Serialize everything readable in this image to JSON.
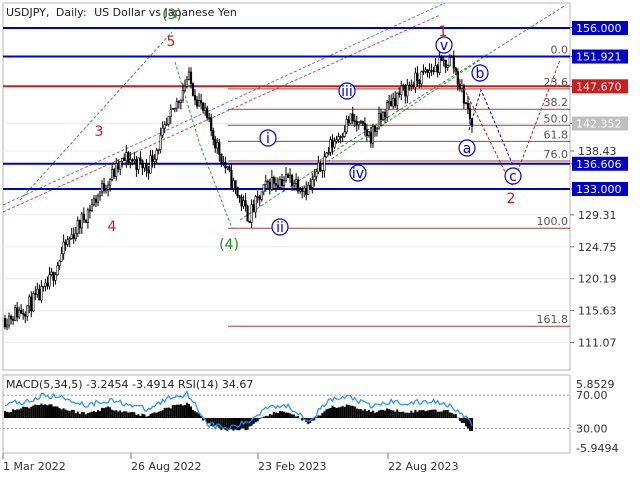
{
  "header": {
    "symbol": "USDJPY",
    "timeframe": "Daily:",
    "description": "US Dollar vs Japanese Yen"
  },
  "colors": {
    "blue": "#0000c8",
    "red": "#c81e1e",
    "green": "#2a8a2a",
    "gray_box": "#c0c0c0",
    "candle": "#000000"
  },
  "chart_data": [
    {
      "type": "line",
      "title": "USDJPY, Daily:  US Dollar vs Japanese Yen",
      "xlabel": "",
      "ylabel": "",
      "ylim": [
        108.5,
        158.5
      ],
      "x_tick_labels": [
        "1 Mar 2022",
        "26 Aug 2022",
        "23 Feb 2023",
        "22 Aug 2023"
      ],
      "y_tick_labels": [
        156.07,
        151.921,
        147.67,
        142.352,
        138.43,
        136.606,
        133.0,
        129.31,
        124.75,
        120.19,
        115.63,
        111.07
      ],
      "price_level_labels": [
        {
          "value": "156.000",
          "style": "blue"
        },
        {
          "value": "151.921",
          "style": "blue"
        },
        {
          "value": "147.670",
          "style": "red"
        },
        {
          "value": "142.352",
          "style": "gray"
        },
        {
          "value": "136.606",
          "style": "blue"
        },
        {
          "value": "133.000",
          "style": "blue"
        }
      ],
      "horizontal_lines": [
        {
          "value": 156.0,
          "color": "blue"
        },
        {
          "value": 151.921,
          "color": "blue"
        },
        {
          "value": 147.67,
          "color": "red"
        },
        {
          "value": 136.606,
          "color": "blue"
        },
        {
          "value": 133.0,
          "color": "blue"
        }
      ],
      "fib_levels": [
        {
          "label": "0.0",
          "value": 151.921
        },
        {
          "label": "23.6",
          "value": 147.3
        },
        {
          "label": "38.2",
          "value": 144.4
        },
        {
          "label": "50.0",
          "value": 142.1
        },
        {
          "label": "61.8",
          "value": 139.8
        },
        {
          "label": "76.0",
          "value": 137.0
        },
        {
          "label": "100.0",
          "value": 127.4
        },
        {
          "label": "161.8",
          "value": 113.4
        }
      ],
      "wave_labels": [
        {
          "text": "3",
          "color": "red"
        },
        {
          "text": "4",
          "color": "red"
        },
        {
          "text": "5",
          "color": "red"
        },
        {
          "text": "(3)",
          "color": "green"
        },
        {
          "text": "(4)",
          "color": "green"
        },
        {
          "text": "i",
          "color": "blue",
          "circled": true
        },
        {
          "text": "ii",
          "color": "blue",
          "circled": true
        },
        {
          "text": "iii",
          "color": "blue",
          "circled": true
        },
        {
          "text": "iv",
          "color": "blue",
          "circled": true
        },
        {
          "text": "v",
          "color": "blue",
          "circled": true
        },
        {
          "text": "1",
          "color": "red"
        },
        {
          "text": "a",
          "color": "blue",
          "circled": true
        },
        {
          "text": "b",
          "color": "blue",
          "circled": true
        },
        {
          "text": "c",
          "color": "blue",
          "circled": true
        },
        {
          "text": "2",
          "color": "red"
        }
      ],
      "series": [
        {
          "x": [
            "2022-01",
            "2022-02",
            "2022-03",
            "2022-04",
            "2022-05",
            "2022-06",
            "2022-07",
            "2022-08",
            "2022-09",
            "2022-10",
            "2022-11",
            "2022-12",
            "2023-01",
            "2023-02",
            "2023-03",
            "2023-04",
            "2023-05",
            "2023-06",
            "2023-07",
            "2023-08",
            "2023-09",
            "2023-10",
            "2023-11",
            "2023-12"
          ],
          "values": [
            114.5,
            116.0,
            118.5,
            125.0,
            129.5,
            134.0,
            137.5,
            136.0,
            142.0,
            149.0,
            142.5,
            135.0,
            129.0,
            134.0,
            134.5,
            133.0,
            139.0,
            143.0,
            140.5,
            145.5,
            148.0,
            150.0,
            151.5,
            142.4
          ]
        }
      ]
    },
    {
      "type": "line",
      "title": "MACD(5,34,5) -3.2454 -3.4914 RSI(14) 34.67",
      "indicator_title": "MACD(5,34,5) -3.2454 -3.4914 RSI(14) 34.67",
      "y_tick_labels": [
        "5.8529",
        "70.00",
        "30.00",
        "-5.9494"
      ],
      "rsi_levels": [
        70,
        30
      ],
      "series": [
        {
          "name": "MACD",
          "values": [
            1.5,
            2.5,
            3.5,
            2.0,
            1.0,
            2.5,
            1.5,
            0.5,
            2.5,
            3.5,
            -1.5,
            -3.0,
            -2.5,
            1.0,
            1.5,
            -1.5,
            2.5,
            3.0,
            1.5,
            2.0,
            1.5,
            2.0,
            1.5,
            -3.2454
          ]
        },
        {
          "name": "RSI",
          "values": [
            60,
            62,
            70,
            66,
            58,
            64,
            60,
            52,
            66,
            72,
            35,
            30,
            38,
            58,
            56,
            40,
            64,
            68,
            56,
            62,
            60,
            63,
            58,
            34.67
          ]
        }
      ]
    }
  ]
}
